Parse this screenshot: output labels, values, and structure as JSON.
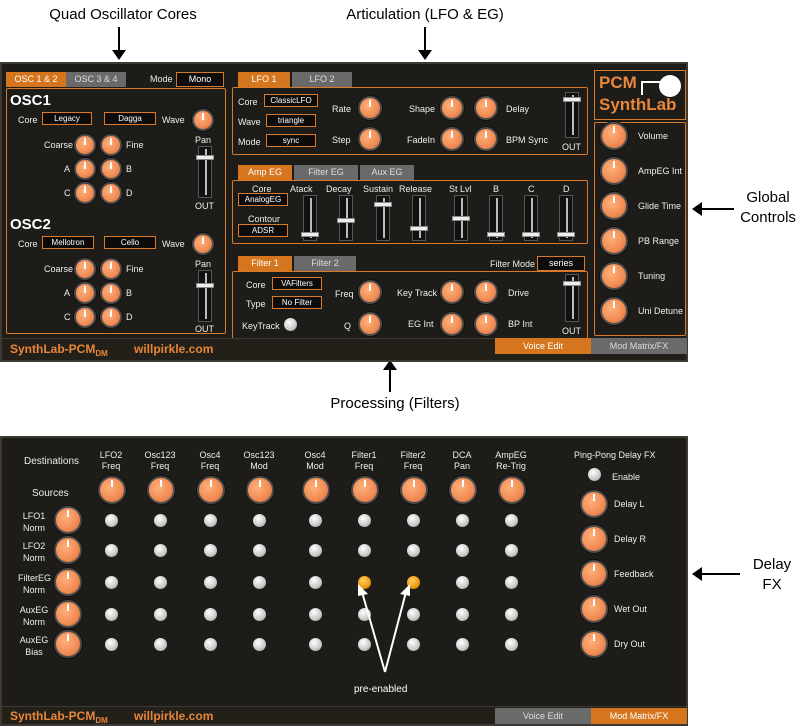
{
  "annotations": {
    "quad": "Quad Oscillator Cores",
    "artic": "Articulation (LFO & EG)",
    "global": "Global\nControls",
    "proc": "Processing (Filters)",
    "delay": "Delay\nFX",
    "preenabled": "pre-enabled"
  },
  "osc": {
    "tab1": "OSC 1 & 2",
    "tab2": "OSC 3 & 4",
    "mode_label": "Mode",
    "mode_value": "Mono",
    "osc1": {
      "title": "OSC1",
      "core_label": "Core",
      "core_value": "Legacy",
      "wave_value": "Dagga",
      "wave_label": "Wave",
      "coarse": "Coarse",
      "fine": "Fine",
      "a": "A",
      "b": "B",
      "c": "C",
      "d": "D"
    },
    "osc2": {
      "title": "OSC2",
      "core_label": "Core",
      "core_value": "Mellotron",
      "wave_value": "Cello",
      "wave_label": "Wave",
      "coarse": "Coarse",
      "fine": "Fine",
      "a": "A",
      "b": "B",
      "c": "C",
      "d": "D"
    },
    "pan": "Pan",
    "out": "OUT"
  },
  "lfo": {
    "tab1": "LFO 1",
    "tab2": "LFO 2",
    "core_label": "Core",
    "core_value": "ClassicLFO",
    "wave_label": "Wave",
    "wave_value": "triangle",
    "mode_label": "Mode",
    "mode_value": "sync",
    "rate": "Rate",
    "step": "Step",
    "shape": "Shape",
    "fadein": "FadeIn",
    "delay": "Delay",
    "bpm": "BPM Sync",
    "out": "OUT"
  },
  "eg": {
    "tab1": "Amp EG",
    "tab2": "Filter EG",
    "tab3": "Aux EG",
    "core_label": "Core",
    "core_value": "AnalogEG",
    "contour_label": "Contour",
    "contour_value": "ADSR",
    "cols": [
      "Atack",
      "Decay",
      "Sustain",
      "Release",
      "St Lvl",
      "B",
      "C",
      "D"
    ]
  },
  "filter": {
    "tab1": "Filter 1",
    "tab2": "Filter 2",
    "mode_label": "Filter Mode",
    "mode_value": "series",
    "core_label": "Core",
    "core_value": "VAFilters",
    "type_label": "Type",
    "type_value": "No Filter",
    "keytrack": "KeyTrack",
    "freq": "Freq",
    "q": "Q",
    "keytrack2": "Key Track",
    "egint": "EG Int",
    "drive": "Drive",
    "bpint": "BP Int",
    "out": "OUT"
  },
  "logo": {
    "pcm": "PCM",
    "synthlab": "SynthLab"
  },
  "global": [
    "Volume",
    "AmpEG Int",
    "Glide Time",
    "PB Range",
    "Tuning",
    "Uni Detune"
  ],
  "footer": {
    "brand": "SynthLab-PCM",
    "sub": "DM",
    "site": "willpirkle.com",
    "voice": "Voice Edit",
    "mod": "Mod Matrix/FX"
  },
  "matrix": {
    "dest_title": "Destinations",
    "src_title": "Sources",
    "dests": [
      [
        "LFO2",
        "Freq"
      ],
      [
        "Osc123",
        "Freq"
      ],
      [
        "Osc4",
        "Freq"
      ],
      [
        "Osc123",
        "Mod"
      ],
      [
        "Osc4",
        "Mod"
      ],
      [
        "Filter1",
        "Freq"
      ],
      [
        "Filter2",
        "Freq"
      ],
      [
        "DCA",
        "Pan"
      ],
      [
        "AmpEG",
        "Re-Trig"
      ]
    ],
    "sources": [
      [
        "LFO1",
        "Norm"
      ],
      [
        "LFO2",
        "Norm"
      ],
      [
        "FilterEG",
        "Norm"
      ],
      [
        "AuxEG",
        "Norm"
      ],
      [
        "AuxEG",
        "Bias"
      ]
    ],
    "enabled": [
      [
        2,
        5
      ],
      [
        2,
        6
      ]
    ]
  },
  "delayfx": {
    "title": "Ping-Pong Delay FX",
    "enable": "Enable",
    "knobs": [
      "Delay L",
      "Delay R",
      "Feedback",
      "Wet Out",
      "Dry Out"
    ]
  }
}
